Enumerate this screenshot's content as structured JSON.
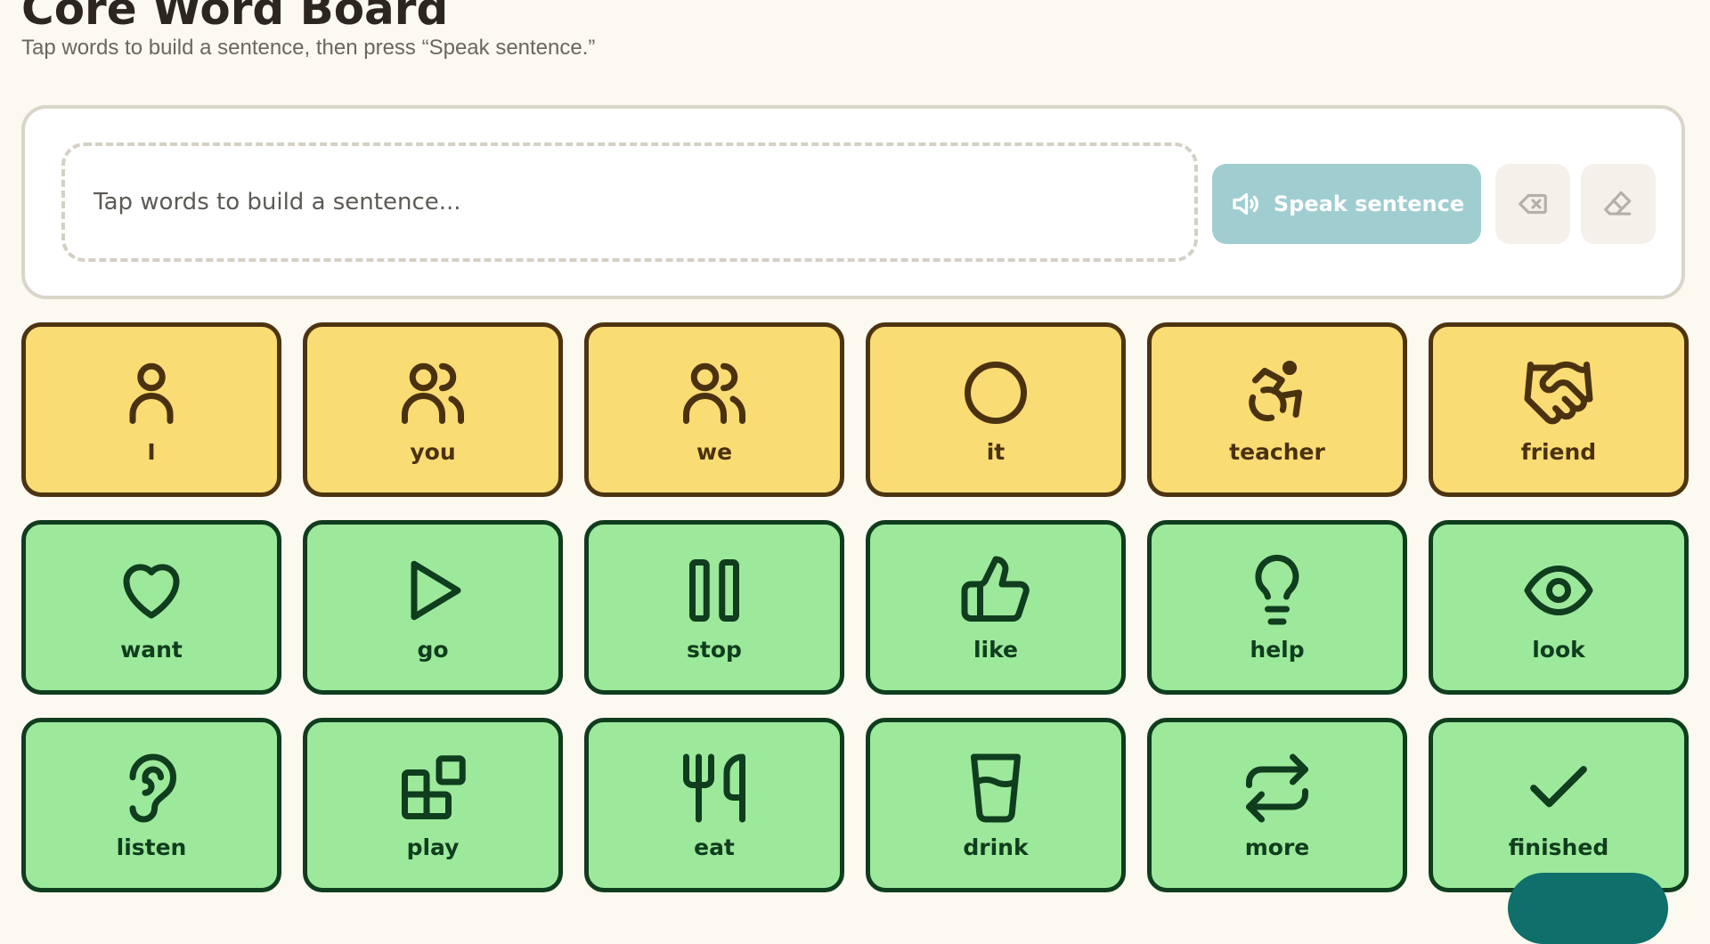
{
  "header": {
    "title": "Core Word Board",
    "subtitle": "Tap words to build a sentence, then press “Speak sentence.”"
  },
  "sentence": {
    "placeholder": "Tap words to build a sentence...",
    "speak_label": "Speak sentence",
    "speak_icon": "speaker-icon",
    "backspace_icon": "backspace-icon",
    "clear_icon": "eraser-icon"
  },
  "colors": {
    "pronoun_tile": "#fadc74",
    "pronoun_border": "#4d3410",
    "verb_tile": "#9ce99b",
    "verb_border": "#0f3d1e",
    "speak_button": "#9fcdd0",
    "fab": "#0f6f6a"
  },
  "tiles": [
    {
      "label": "I",
      "icon": "person-icon",
      "group": "pronoun"
    },
    {
      "label": "you",
      "icon": "people-icon",
      "group": "pronoun"
    },
    {
      "label": "we",
      "icon": "group-icon",
      "group": "pronoun"
    },
    {
      "label": "it",
      "icon": "circle-icon",
      "group": "pronoun"
    },
    {
      "label": "teacher",
      "icon": "accessibility-icon",
      "group": "pronoun"
    },
    {
      "label": "friend",
      "icon": "handshake-icon",
      "group": "pronoun"
    },
    {
      "label": "want",
      "icon": "heart-icon",
      "group": "verb"
    },
    {
      "label": "go",
      "icon": "play-icon",
      "group": "verb"
    },
    {
      "label": "stop",
      "icon": "pause-icon",
      "group": "verb"
    },
    {
      "label": "like",
      "icon": "thumbs-up-icon",
      "group": "verb"
    },
    {
      "label": "help",
      "icon": "lightbulb-icon",
      "group": "verb"
    },
    {
      "label": "look",
      "icon": "eye-icon",
      "group": "verb"
    },
    {
      "label": "listen",
      "icon": "ear-icon",
      "group": "verb"
    },
    {
      "label": "play",
      "icon": "blocks-icon",
      "group": "verb"
    },
    {
      "label": "eat",
      "icon": "utensils-icon",
      "group": "verb"
    },
    {
      "label": "drink",
      "icon": "cup-icon",
      "group": "verb"
    },
    {
      "label": "more",
      "icon": "repeat-icon",
      "group": "verb"
    },
    {
      "label": "finished",
      "icon": "check-icon",
      "group": "verb"
    }
  ]
}
